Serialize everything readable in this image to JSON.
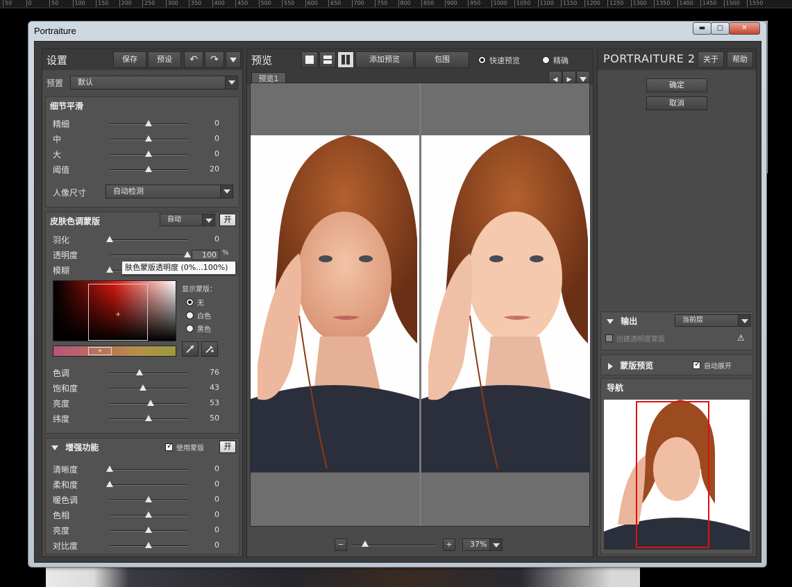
{
  "ruler": {
    "ticks": [
      "50",
      "0",
      "50",
      "100",
      "150",
      "200",
      "250",
      "300",
      "350",
      "400",
      "450",
      "500",
      "550",
      "600",
      "650",
      "700",
      "750",
      "800",
      "850",
      "900",
      "950",
      "1000",
      "1050",
      "1100",
      "1150",
      "1200",
      "1250",
      "1300",
      "1350",
      "1400",
      "1450",
      "1500",
      "1550"
    ]
  },
  "window": {
    "title": "Portraiture",
    "min_label": "▬",
    "max_label": "▢",
    "close_label": "✕"
  },
  "left_panel": {
    "header_title": "设置",
    "save_label": "保存",
    "presets_label": "预设",
    "undo_icon": "↶",
    "redo_icon": "↷",
    "preset_label": "预置",
    "preset_value": "默认",
    "detail_smoothing": {
      "title": "细节平滑",
      "rows": [
        {
          "label": "精细",
          "value": "0",
          "pos": 0.5
        },
        {
          "label": "中",
          "value": "0",
          "pos": 0.5
        },
        {
          "label": "大",
          "value": "0",
          "pos": 0.5
        },
        {
          "label": "阈值",
          "value": "20",
          "pos": 0.5
        }
      ],
      "portrait_size_label": "人像尺寸",
      "portrait_size_value": "自动检测"
    },
    "skin_mask": {
      "title": "皮肤色调蒙版",
      "mode_value": "自动",
      "toggle_label": "开",
      "rows": [
        {
          "label": "羽化",
          "value": "0",
          "pos": 0.0
        },
        {
          "label": "透明度",
          "value": "100",
          "pos": 1.0
        },
        {
          "label": "模糊",
          "value": "",
          "pos": 0.0
        }
      ],
      "percent_sign": "%",
      "show_mask_label": "显示蒙版：",
      "show_mask_options": [
        "无",
        "白色",
        "黑色"
      ],
      "show_mask_selected": 0,
      "hue_rows": [
        {
          "label": "色调",
          "value": "76",
          "pos": 0.38
        },
        {
          "label": "饱和度",
          "value": "43",
          "pos": 0.43
        },
        {
          "label": "亮度",
          "value": "53",
          "pos": 0.53
        },
        {
          "label": "纬度",
          "value": "50",
          "pos": 0.5
        }
      ]
    },
    "enhancements": {
      "title": "增强功能",
      "use_mask_label": "使用蒙版",
      "use_mask_checked": true,
      "toggle_label": "开",
      "rows": [
        {
          "label": "清晰度",
          "value": "0",
          "pos": 0.0
        },
        {
          "label": "柔和度",
          "value": "0",
          "pos": 0.0
        },
        {
          "label": "暖色调",
          "value": "0",
          "pos": 0.5
        },
        {
          "label": "色相",
          "value": "0",
          "pos": 0.5
        },
        {
          "label": "亮度",
          "value": "0",
          "pos": 0.5
        },
        {
          "label": "对比度",
          "value": "0",
          "pos": 0.5
        }
      ]
    },
    "tooltip": "肤色蒙版透明度 (0%...100%)"
  },
  "center_panel": {
    "header_title": "预览",
    "add_preview_label": "添加预览",
    "wrap_label": "包围",
    "quick_preview_label": "快速预览",
    "precise_label": "精确",
    "quick_selected": true,
    "tab_label": "预览1",
    "zoom_minus": "−",
    "zoom_plus": "+",
    "zoom_value": "37%",
    "zoom_level": 0.15
  },
  "right_panel": {
    "brand": "PORTRAITURE 2",
    "about_label": "关于",
    "help_label": "帮助",
    "ok_label": "确定",
    "cancel_label": "取消",
    "output_title": "输出",
    "output_value": "当前层",
    "create_mask_label": "创建透明度蒙版",
    "mask_preview_title": "蒙版预览",
    "auto_expand_label": "自动展开",
    "auto_expand_checked": true,
    "nav_title": "导航"
  },
  "colors": {
    "accent_red": "#e01010",
    "panel_bg": "#4a4a4a",
    "section_bg": "#525252"
  }
}
